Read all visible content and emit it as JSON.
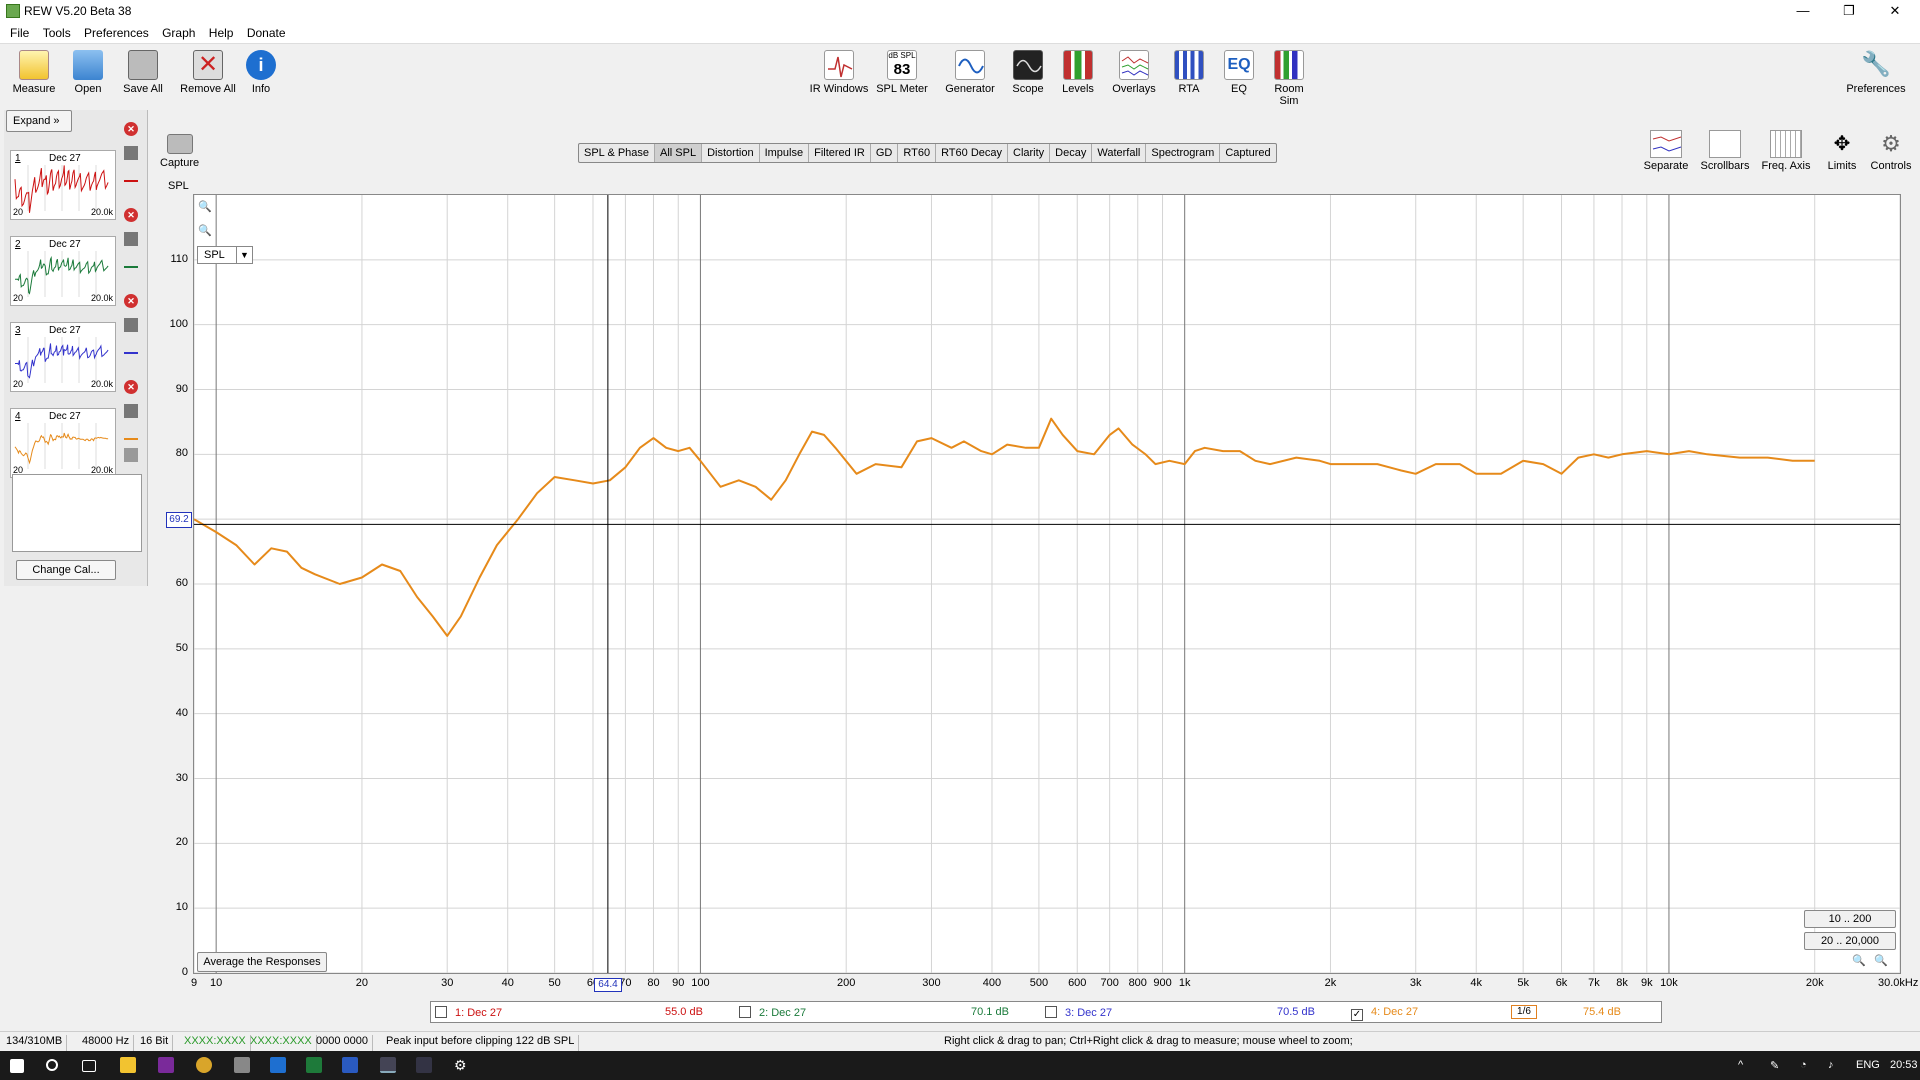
{
  "window": {
    "title": "REW V5.20 Beta 38",
    "min": "—",
    "max": "❐",
    "close": "✕"
  },
  "menu": [
    "File",
    "Tools",
    "Preferences",
    "Graph",
    "Help",
    "Donate"
  ],
  "toolbar_left": [
    {
      "label": "Measure",
      "icon": "measure-icon",
      "color": "#f2c330"
    },
    {
      "label": "Open",
      "icon": "folder-icon",
      "color": "#3c84d0"
    },
    {
      "label": "Save All",
      "icon": "save-icon",
      "color": "#7a7a7a"
    },
    {
      "label": "Remove All",
      "icon": "remove-icon",
      "color": "#cc2222"
    },
    {
      "label": "Info",
      "icon": "info-icon",
      "color": "#1e6fd0"
    }
  ],
  "toolbar_center": [
    {
      "label": "IR Windows",
      "icon": "ir-windows-icon"
    },
    {
      "label": "SPL Meter",
      "icon": "spl-meter-icon",
      "top": "dB SPL",
      "value": "83"
    },
    {
      "label": "Generator",
      "icon": "generator-icon"
    },
    {
      "label": "Scope",
      "icon": "scope-icon"
    },
    {
      "label": "Levels",
      "icon": "levels-icon"
    },
    {
      "label": "Overlays",
      "icon": "overlays-icon"
    },
    {
      "label": "RTA",
      "icon": "rta-icon"
    },
    {
      "label": "EQ",
      "icon": "eq-icon",
      "glyph": "EQ"
    },
    {
      "label": "Room Sim",
      "icon": "room-sim-icon"
    }
  ],
  "toolbar_right": {
    "label": "Preferences",
    "icon": "wrench-icon"
  },
  "left_panel": {
    "expand_label": "Expand",
    "measurements": [
      {
        "num": "1",
        "date": "Dec 27",
        "lo": "20",
        "hi": "20.0k",
        "color": "#cc1111"
      },
      {
        "num": "2",
        "date": "Dec 27",
        "lo": "20",
        "hi": "20.0k",
        "color": "#1a7a3a"
      },
      {
        "num": "3",
        "date": "Dec 27",
        "lo": "20",
        "hi": "20.0k",
        "color": "#3333cc"
      },
      {
        "num": "4",
        "date": "Dec 27",
        "lo": "20",
        "hi": "20.0k",
        "color": "#e68a1a"
      }
    ],
    "change_cal": "Change Cal..."
  },
  "capture_label": "Capture",
  "tabs": [
    "SPL & Phase",
    "All SPL",
    "Distortion",
    "Impulse",
    "Filtered IR",
    "GD",
    "RT60",
    "RT60 Decay",
    "Clarity",
    "Decay",
    "Waterfall",
    "Spectrogram",
    "Captured"
  ],
  "active_tab": "All SPL",
  "right_tools": [
    {
      "label": "Separate",
      "icon": "separate-icon"
    },
    {
      "label": "Scrollbars",
      "icon": "scrollbars-icon"
    },
    {
      "label": "Freq. Axis",
      "icon": "freq-axis-icon"
    },
    {
      "label": "Limits",
      "icon": "limits-icon"
    },
    {
      "label": "Controls",
      "icon": "gear-icon"
    }
  ],
  "graph": {
    "axis_label": "SPL",
    "selector_value": "SPL",
    "avg_button": "Average the Responses",
    "range_buttons": [
      "10 .. 200",
      "20 .. 20,000"
    ],
    "cursor_y": "69.2",
    "cursor_x": "64.4"
  },
  "chart_data": {
    "type": "line",
    "title": "",
    "xlabel": "",
    "ylabel": "SPL",
    "x_scale": "log",
    "xlim": [
      9,
      30000
    ],
    "ylim": [
      0,
      120
    ],
    "grid": true,
    "y_ticks": [
      "0",
      "10",
      "20",
      "30",
      "40",
      "50",
      "60",
      "70",
      "80",
      "90",
      "100",
      "110"
    ],
    "x_ticks": [
      {
        "v": 9,
        "l": "9"
      },
      {
        "v": 10,
        "l": "10"
      },
      {
        "v": 20,
        "l": "20"
      },
      {
        "v": 30,
        "l": "30"
      },
      {
        "v": 40,
        "l": "40"
      },
      {
        "v": 50,
        "l": "50"
      },
      {
        "v": 60,
        "l": "60"
      },
      {
        "v": 70,
        "l": "70"
      },
      {
        "v": 80,
        "l": "80"
      },
      {
        "v": 90,
        "l": "90"
      },
      {
        "v": 100,
        "l": "100"
      },
      {
        "v": 200,
        "l": "200"
      },
      {
        "v": 300,
        "l": "300"
      },
      {
        "v": 400,
        "l": "400"
      },
      {
        "v": 500,
        "l": "500"
      },
      {
        "v": 600,
        "l": "600"
      },
      {
        "v": 700,
        "l": "700"
      },
      {
        "v": 800,
        "l": "800"
      },
      {
        "v": 900,
        "l": "900"
      },
      {
        "v": 1000,
        "l": "1k"
      },
      {
        "v": 2000,
        "l": "2k"
      },
      {
        "v": 3000,
        "l": "3k"
      },
      {
        "v": 4000,
        "l": "4k"
      },
      {
        "v": 5000,
        "l": "5k"
      },
      {
        "v": 6000,
        "l": "6k"
      },
      {
        "v": 7000,
        "l": "7k"
      },
      {
        "v": 8000,
        "l": "8k"
      },
      {
        "v": 9000,
        "l": "9k"
      },
      {
        "v": 10000,
        "l": "10k"
      },
      {
        "v": 20000,
        "l": "20k"
      },
      {
        "v": 30000,
        "l": "30.0kHz"
      }
    ],
    "cursor": {
      "x": 64.4,
      "y": 69.2
    },
    "series": [
      {
        "color": "#e68a1a",
        "points": [
          [
            9,
            70
          ],
          [
            10,
            68
          ],
          [
            11,
            66
          ],
          [
            12,
            63
          ],
          [
            13,
            65.5
          ],
          [
            14,
            65
          ],
          [
            15,
            62.5
          ],
          [
            16,
            61.5
          ],
          [
            18,
            60
          ],
          [
            20,
            61
          ],
          [
            22,
            63
          ],
          [
            24,
            62
          ],
          [
            26,
            58
          ],
          [
            28,
            55
          ],
          [
            30,
            52
          ],
          [
            32,
            55
          ],
          [
            35,
            61
          ],
          [
            38,
            66
          ],
          [
            42,
            70
          ],
          [
            46,
            74
          ],
          [
            50,
            76.5
          ],
          [
            55,
            76
          ],
          [
            60,
            75.5
          ],
          [
            65,
            76
          ],
          [
            70,
            78
          ],
          [
            75,
            81
          ],
          [
            80,
            82.5
          ],
          [
            85,
            81
          ],
          [
            90,
            80.5
          ],
          [
            95,
            81
          ],
          [
            100,
            79
          ],
          [
            110,
            75
          ],
          [
            120,
            76
          ],
          [
            130,
            75
          ],
          [
            140,
            73
          ],
          [
            150,
            76
          ],
          [
            160,
            80
          ],
          [
            170,
            83.5
          ],
          [
            180,
            83
          ],
          [
            190,
            81
          ],
          [
            210,
            77
          ],
          [
            230,
            78.5
          ],
          [
            260,
            78
          ],
          [
            280,
            82
          ],
          [
            300,
            82.5
          ],
          [
            330,
            81
          ],
          [
            350,
            82
          ],
          [
            380,
            80.5
          ],
          [
            400,
            80
          ],
          [
            430,
            81.5
          ],
          [
            470,
            81
          ],
          [
            500,
            81
          ],
          [
            530,
            85.5
          ],
          [
            560,
            83
          ],
          [
            600,
            80.5
          ],
          [
            650,
            80
          ],
          [
            700,
            83
          ],
          [
            730,
            84
          ],
          [
            780,
            81.5
          ],
          [
            830,
            80
          ],
          [
            870,
            78.5
          ],
          [
            930,
            79
          ],
          [
            1000,
            78.5
          ],
          [
            1050,
            80.5
          ],
          [
            1100,
            81
          ],
          [
            1200,
            80.5
          ],
          [
            1300,
            80.5
          ],
          [
            1400,
            79
          ],
          [
            1500,
            78.5
          ],
          [
            1700,
            79.5
          ],
          [
            1900,
            79
          ],
          [
            2000,
            78.5
          ],
          [
            2200,
            78.5
          ],
          [
            2500,
            78.5
          ],
          [
            2800,
            77.5
          ],
          [
            3000,
            77
          ],
          [
            3300,
            78.5
          ],
          [
            3700,
            78.5
          ],
          [
            4000,
            77
          ],
          [
            4500,
            77
          ],
          [
            5000,
            79
          ],
          [
            5500,
            78.5
          ],
          [
            6000,
            77
          ],
          [
            6500,
            79.5
          ],
          [
            7000,
            80
          ],
          [
            7500,
            79.5
          ],
          [
            8000,
            80
          ],
          [
            9000,
            80.5
          ],
          [
            10000,
            80
          ],
          [
            11000,
            80.5
          ],
          [
            12000,
            80
          ],
          [
            14000,
            79.5
          ],
          [
            16000,
            79.5
          ],
          [
            18000,
            79
          ],
          [
            20000,
            79
          ]
        ]
      }
    ]
  },
  "legend": [
    {
      "label": "1: Dec 27",
      "value": "55.0 dB",
      "checked": false,
      "color": "#cc1111"
    },
    {
      "label": "2: Dec 27",
      "value": "70.1 dB",
      "checked": false,
      "color": "#1a7a3a"
    },
    {
      "label": "3: Dec 27",
      "value": "70.5 dB",
      "checked": false,
      "color": "#3333cc"
    },
    {
      "label": "4: Dec 27",
      "value": "75.4 dB",
      "checked": true,
      "color": "#e68a1a"
    }
  ],
  "smoothing": "1/6",
  "status": {
    "memory": "134/310MB",
    "rate": "48000 Hz",
    "bits": "16 Bit",
    "clip_msg": "Peak input before clipping 122 dB SPL",
    "hint": "Right click & drag to pan; Ctrl+Right click & drag to measure; mouse wheel to zoom;",
    "left_meter": "XXXX:XXXX",
    "right_meter": "XXXX:XXXX",
    "counter": "0000 0000"
  },
  "taskbar": {
    "lang": "ENG",
    "time": "20:53"
  }
}
